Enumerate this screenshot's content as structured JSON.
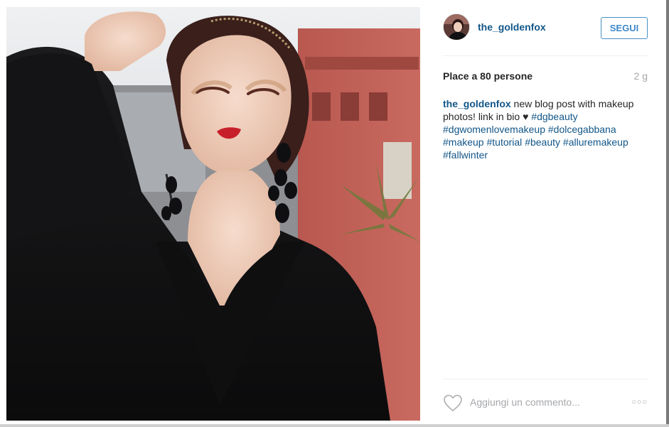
{
  "post": {
    "username": "the_goldenfox",
    "follow_label": "SEGUI",
    "likes_text": "Place a 80 persone",
    "time_ago": "2 g",
    "caption": {
      "username": "the_goldenfox",
      "text": " new blog post with makeup photos! link in bio ♥ ",
      "hashtags": [
        "#dgbeauty",
        "#dgwomenlovemakeup",
        "#dolcegabbana",
        "#makeup",
        "#tutorial",
        "#beauty",
        "#alluremakeup",
        "#fallwinter"
      ]
    },
    "comment_placeholder": "Aggiungi un commento...",
    "more_label": "○○○"
  },
  "icons": {
    "like": "heart-outline-icon",
    "more": "more-options-icon"
  },
  "colors": {
    "link": "#125688",
    "follow_border": "#4a90c4",
    "muted_text": "#a5a7aa",
    "body_text": "#262626"
  }
}
